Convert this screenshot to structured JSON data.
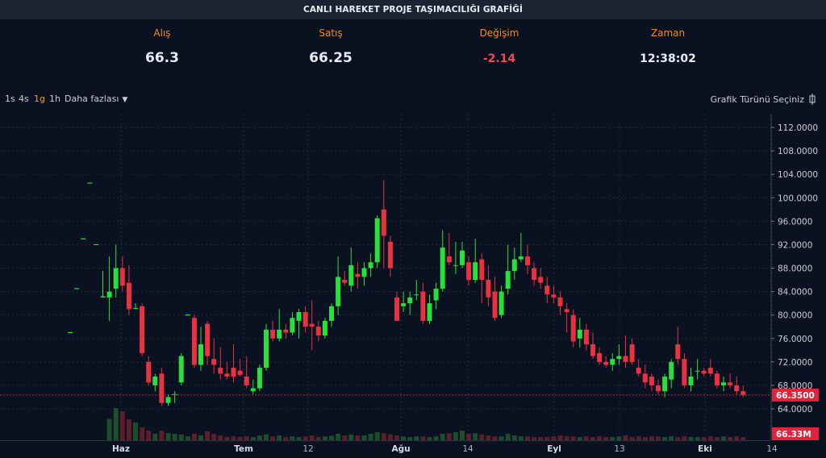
{
  "header": {
    "title": "CANLI HAREKET PROJE TAŞIMACILIĞI GRAFİĞİ"
  },
  "quote": {
    "bid_label": "Alış",
    "bid_value": "66.3",
    "ask_label": "Satış",
    "ask_value": "66.25",
    "change_label": "Değişim",
    "change_value": "-2.14",
    "time_label": "Zaman",
    "time_value": "12:38:02"
  },
  "toolbar": {
    "timeframes": [
      "1s",
      "4s",
      "1g",
      "1h"
    ],
    "active_timeframe": "1g",
    "more_label": "Daha fazlası",
    "chart_type_label": "Grafik Türünü Seçiniz"
  },
  "colors": {
    "up": "#27e03a",
    "down": "#e8323f",
    "accent": "#f08c24",
    "last_price_bg": "#e0243a"
  },
  "icons": {
    "more": "chevron-down-icon",
    "chart_type": "candlestick-icon"
  },
  "chart_data": {
    "type": "candlestick",
    "y_ticks": [
      "112.0000",
      "108.0000",
      "104.0000",
      "100.0000",
      "96.0000",
      "92.0000",
      "88.0000",
      "84.0000",
      "80.0000",
      "76.0000",
      "72.0000",
      "68.0000",
      "64.0000"
    ],
    "ylim": [
      62,
      114
    ],
    "x_ticks": [
      "Haz",
      "Tem",
      "12",
      "Ağu",
      "14",
      "Eyl",
      "13",
      "Eki",
      "14"
    ],
    "last_price_label": "66.3500",
    "last_price": 66.35,
    "volume_label": "66.33M",
    "grid": true,
    "candles": [
      [
        77.0,
        77.0,
        77.0,
        77.0
      ],
      [
        84.5,
        84.5,
        84.5,
        84.5
      ],
      [
        93.0,
        93.0,
        93.0,
        93.0
      ],
      [
        102.5,
        102.5,
        102.5,
        102.5
      ],
      [
        92.0,
        92.0,
        92.0,
        92.0
      ],
      [
        83.0,
        87.5,
        83.0,
        83.2
      ],
      [
        83.0,
        90.0,
        79.0,
        84.0
      ],
      [
        84.5,
        92.0,
        83.0,
        88.0
      ],
      [
        88.0,
        90.0,
        84.0,
        85.0
      ],
      [
        85.5,
        88.5,
        80.0,
        81.0
      ],
      [
        81.2,
        82.0,
        81.0,
        81.2
      ],
      [
        81.5,
        82.0,
        73.0,
        73.5
      ],
      [
        72.0,
        73.0,
        68.0,
        68.5
      ],
      [
        68.0,
        70.0,
        67.0,
        69.5
      ],
      [
        70.0,
        71.0,
        64.5,
        65.0
      ],
      [
        65.0,
        66.5,
        64.5,
        66.0
      ],
      [
        66.5,
        67.0,
        65.0,
        66.5
      ],
      [
        68.5,
        73.5,
        68.0,
        73.0
      ],
      [
        80.0,
        80.0,
        80.0,
        80.0
      ],
      [
        79.5,
        80.0,
        71.0,
        71.5
      ],
      [
        71.5,
        78.0,
        70.5,
        75.0
      ],
      [
        78.5,
        79.0,
        71.5,
        73.0
      ],
      [
        72.5,
        76.0,
        70.0,
        71.5
      ],
      [
        71.0,
        74.5,
        69.0,
        70.0
      ],
      [
        70.0,
        72.0,
        69.0,
        69.5
      ],
      [
        71.0,
        75.0,
        68.5,
        69.5
      ],
      [
        70.5,
        72.5,
        69.5,
        69.8
      ],
      [
        69.5,
        73.0,
        67.5,
        68.0
      ],
      [
        67.0,
        69.0,
        66.5,
        67.5
      ],
      [
        67.5,
        71.5,
        67.0,
        71.0
      ],
      [
        71.0,
        78.5,
        70.5,
        77.5
      ],
      [
        77.5,
        79.0,
        75.5,
        76.0
      ],
      [
        76.0,
        81.0,
        75.5,
        77.5
      ],
      [
        77.5,
        78.5,
        76.0,
        77.0
      ],
      [
        77.0,
        80.5,
        76.5,
        79.5
      ],
      [
        79.0,
        81.0,
        76.0,
        80.5
      ],
      [
        80.5,
        81.5,
        77.0,
        78.0
      ],
      [
        78.5,
        82.5,
        74.0,
        78.0
      ],
      [
        78.0,
        79.0,
        75.5,
        76.5
      ],
      [
        76.5,
        79.5,
        76.0,
        79.0
      ],
      [
        79.0,
        82.0,
        78.0,
        81.5
      ],
      [
        81.5,
        90.0,
        80.0,
        86.5
      ],
      [
        86.0,
        87.5,
        85.0,
        85.5
      ],
      [
        85.0,
        91.5,
        84.0,
        88.5
      ],
      [
        87.0,
        89.0,
        84.5,
        86.5
      ],
      [
        86.5,
        89.0,
        85.0,
        88.0
      ],
      [
        88.0,
        90.5,
        86.5,
        89.0
      ],
      [
        89.0,
        97.0,
        88.0,
        96.5
      ],
      [
        98.0,
        103.0,
        88.0,
        93.5
      ],
      [
        92.5,
        93.5,
        86.5,
        88.0
      ],
      [
        83.0,
        84.0,
        79.0,
        79.0
      ],
      [
        81.5,
        84.0,
        80.5,
        82.0
      ],
      [
        82.0,
        84.0,
        80.0,
        83.0
      ],
      [
        83.5,
        86.0,
        82.5,
        83.5
      ],
      [
        84.0,
        85.5,
        78.5,
        79.0
      ],
      [
        79.0,
        83.5,
        78.5,
        82.0
      ],
      [
        82.5,
        85.5,
        81.0,
        84.5
      ],
      [
        84.5,
        94.5,
        84.0,
        91.5
      ],
      [
        90.0,
        94.0,
        88.5,
        89.0
      ],
      [
        88.5,
        92.5,
        87.0,
        88.5
      ],
      [
        88.5,
        92.5,
        88.0,
        91.0
      ],
      [
        89.0,
        90.0,
        85.0,
        86.0
      ],
      [
        86.0,
        93.0,
        85.5,
        89.0
      ],
      [
        89.5,
        90.5,
        82.0,
        86.0
      ],
      [
        86.0,
        88.5,
        81.5,
        83.0
      ],
      [
        84.0,
        86.5,
        79.0,
        79.5
      ],
      [
        80.0,
        85.0,
        79.5,
        84.0
      ],
      [
        84.5,
        92.0,
        83.5,
        87.5
      ],
      [
        87.5,
        91.5,
        86.0,
        89.5
      ],
      [
        89.5,
        94.0,
        89.0,
        90.0
      ],
      [
        90.0,
        92.0,
        87.0,
        88.5
      ],
      [
        88.0,
        89.0,
        85.0,
        86.0
      ],
      [
        86.5,
        88.0,
        84.5,
        85.5
      ],
      [
        85.0,
        86.5,
        82.0,
        83.5
      ],
      [
        83.5,
        85.0,
        82.0,
        83.0
      ],
      [
        83.0,
        84.0,
        80.0,
        81.5
      ],
      [
        81.0,
        82.0,
        77.0,
        80.5
      ],
      [
        80.0,
        81.0,
        74.5,
        75.5
      ],
      [
        76.0,
        79.5,
        74.5,
        77.5
      ],
      [
        77.5,
        78.5,
        74.0,
        75.0
      ],
      [
        75.0,
        77.0,
        72.5,
        73.0
      ],
      [
        73.5,
        74.5,
        71.5,
        72.0
      ],
      [
        72.0,
        73.0,
        71.0,
        71.5
      ],
      [
        71.5,
        73.5,
        70.5,
        72.5
      ],
      [
        72.5,
        75.0,
        71.5,
        73.0
      ],
      [
        73.0,
        76.5,
        71.0,
        72.0
      ],
      [
        75.0,
        76.0,
        71.5,
        72.0
      ],
      [
        71.0,
        72.5,
        69.5,
        70.0
      ],
      [
        70.0,
        71.5,
        67.5,
        68.5
      ],
      [
        69.5,
        70.0,
        67.0,
        68.0
      ],
      [
        68.0,
        69.0,
        66.5,
        67.0
      ],
      [
        67.0,
        70.0,
        66.0,
        69.5
      ],
      [
        69.0,
        72.5,
        67.5,
        72.0
      ],
      [
        75.0,
        78.0,
        71.5,
        72.5
      ],
      [
        72.5,
        73.5,
        67.5,
        68.0
      ],
      [
        68.0,
        71.0,
        67.0,
        69.5
      ],
      [
        70.5,
        72.5,
        69.0,
        70.5
      ],
      [
        70.5,
        71.0,
        69.5,
        70.0
      ],
      [
        71.0,
        72.5,
        69.5,
        70.0
      ],
      [
        70.0,
        70.5,
        67.5,
        68.0
      ],
      [
        68.0,
        69.5,
        67.0,
        68.5
      ],
      [
        68.5,
        70.0,
        67.5,
        68.0
      ],
      [
        68.0,
        69.5,
        66.5,
        67.0
      ],
      [
        67.0,
        68.0,
        66.0,
        66.35
      ]
    ],
    "volume": [
      0,
      0,
      0,
      0,
      0,
      0.0,
      0.66,
      1.0,
      0.9,
      0.65,
      0.55,
      0.4,
      0.3,
      0.2,
      0.3,
      0.22,
      0.2,
      0.18,
      0.12,
      0.2,
      0.15,
      0.28,
      0.2,
      0.15,
      0.1,
      0.12,
      0.1,
      0.12,
      0.1,
      0.15,
      0.18,
      0.12,
      0.15,
      0.1,
      0.12,
      0.1,
      0.12,
      0.15,
      0.1,
      0.12,
      0.14,
      0.2,
      0.15,
      0.18,
      0.15,
      0.15,
      0.2,
      0.25,
      0.22,
      0.18,
      0.15,
      0.12,
      0.1,
      0.12,
      0.12,
      0.1,
      0.12,
      0.2,
      0.22,
      0.25,
      0.3,
      0.2,
      0.22,
      0.18,
      0.15,
      0.12,
      0.12,
      0.2,
      0.15,
      0.12,
      0.12,
      0.1,
      0.1,
      0.1,
      0.12,
      0.15,
      0.12,
      0.12,
      0.1,
      0.12,
      0.1,
      0.12,
      0.1,
      0.1,
      0.12,
      0.15,
      0.1,
      0.12,
      0.1,
      0.12,
      0.12,
      0.1,
      0.12,
      0.1,
      0.12,
      0.1,
      0.1,
      0.1,
      0.12,
      0.1,
      0.12,
      0.1,
      0.12,
      0.1,
      0.14
    ]
  }
}
